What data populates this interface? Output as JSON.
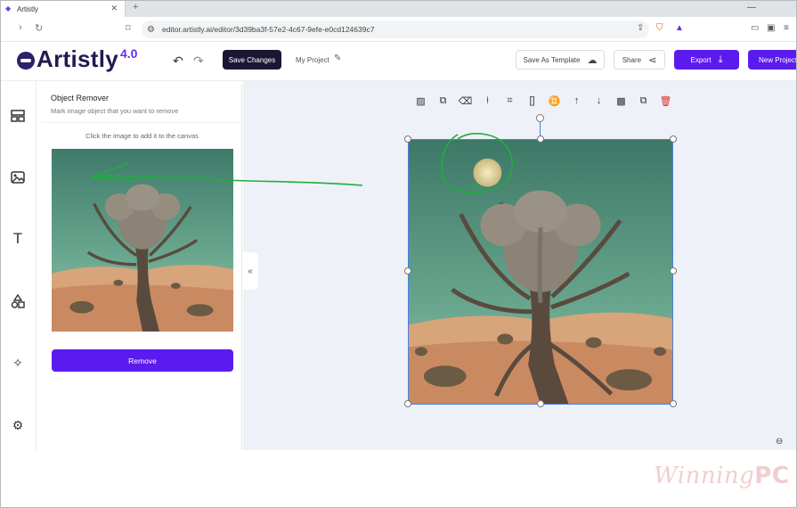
{
  "browser": {
    "tab_title": "Artistly",
    "new_tab": "+",
    "url": "editor.artistly.ai/editor/3d39ba3f-57e2-4c67-9efe-e0cd124639c7"
  },
  "header": {
    "logo_text": "Artistly",
    "logo_version": "4.0",
    "save_changes": "Save Changes",
    "project_name": "My Project",
    "save_as_template": "Save As Template",
    "share": "Share",
    "export": "Export",
    "new_project": "New Project"
  },
  "rail": {
    "items": [
      "layout-icon",
      "image-icon",
      "text-icon",
      "shapes-icon",
      "ai-sparkle-icon",
      "settings-icon"
    ]
  },
  "panel": {
    "title": "Object Remover",
    "subtitle": "Mark image object that you want to remove",
    "hint": "Click the image to add it to the canvas",
    "remove_button": "Remove",
    "collapse": "«"
  },
  "toolbar": {
    "tools": [
      "pattern-icon",
      "adjust-icon",
      "eraser-icon",
      "pin-icon",
      "crop-icon",
      "brackets-icon",
      "paint-roller-icon",
      "arrow-up-icon",
      "arrow-down-icon",
      "transparency-icon",
      "duplicate-icon",
      "trash-icon"
    ]
  },
  "watermark": {
    "word": "Winning",
    "suffix": "PC"
  },
  "colors": {
    "accent": "#5b1bee",
    "dark_button": "#1d1633",
    "annotation": "#1fae3f",
    "selection": "#4a7fe0"
  }
}
